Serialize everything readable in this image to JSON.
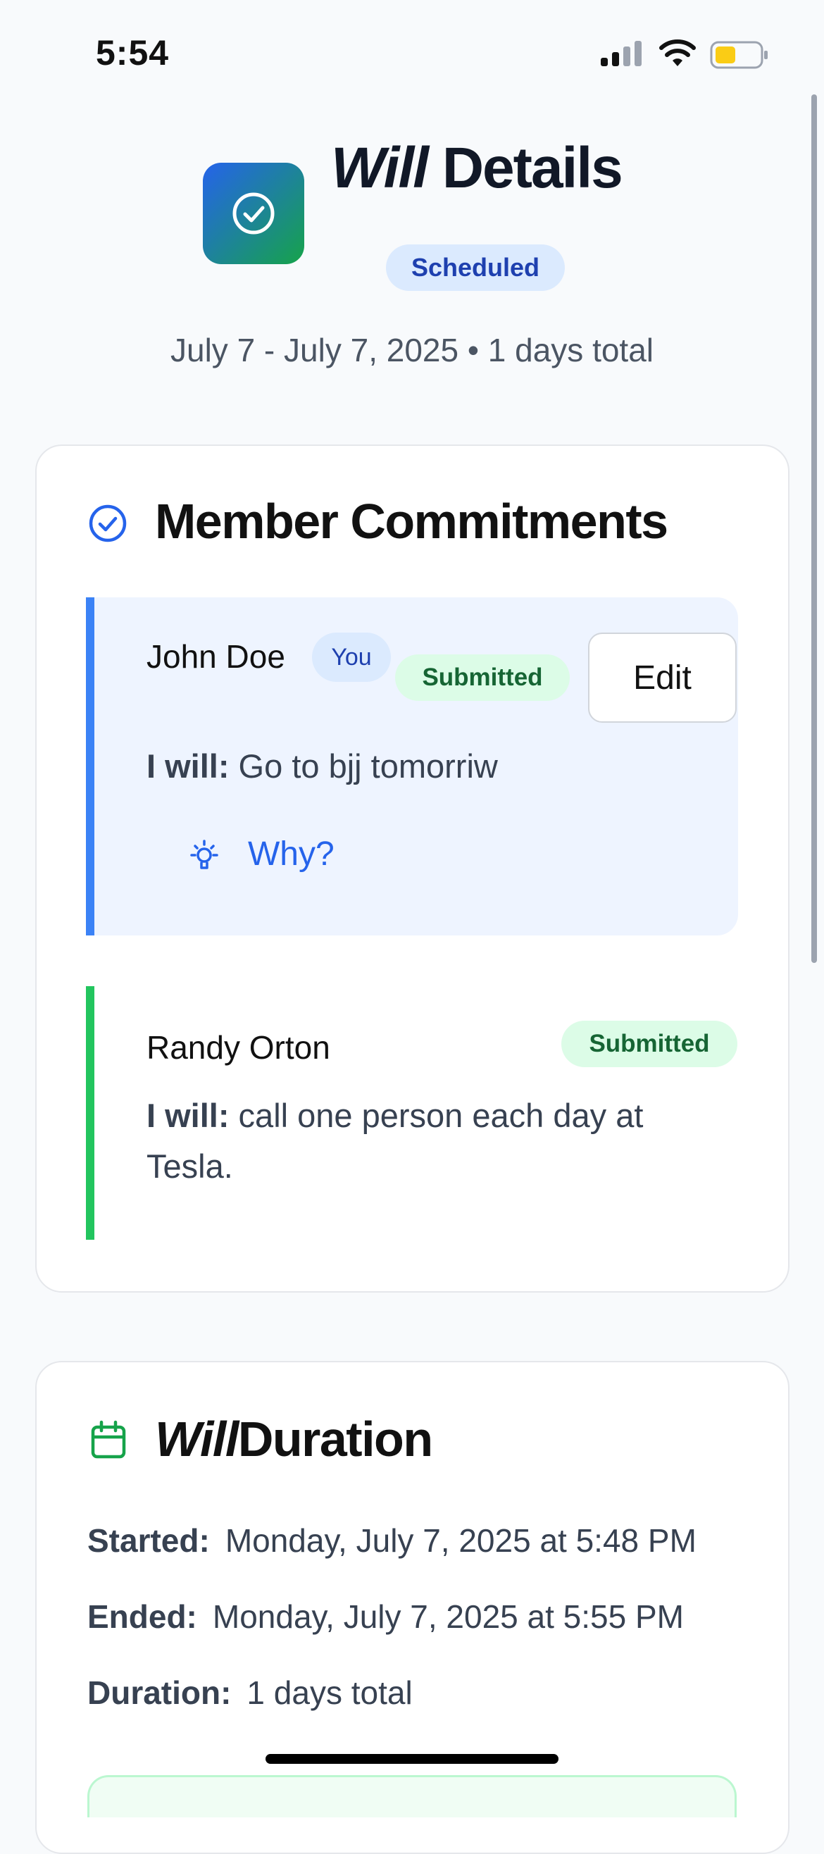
{
  "status_bar": {
    "time": "5:54"
  },
  "header": {
    "title_em": "Will",
    "title_rest": " Details",
    "status_badge": "Scheduled",
    "date_range": "July 7 - July 7, 2025 • 1 days total"
  },
  "commitments": {
    "title": "Member Commitments",
    "members": [
      {
        "name": "John Doe",
        "you_badge": "You",
        "status": "Submitted",
        "edit_label": "Edit",
        "prefix": "I will:",
        "text": " Go to bjj tomorriw",
        "why_label": "Why?",
        "accent": "#3b82f6"
      },
      {
        "name": "Randy Orton",
        "status": "Submitted",
        "prefix": "I will:",
        "text": " call one person each day at Tesla.",
        "accent": "#22c55e"
      }
    ]
  },
  "duration": {
    "title_em": "Will",
    "title_rest": "Duration",
    "started_label": "Started:",
    "started_value": "Monday, July 7, 2025 at 5:48 PM",
    "ended_label": "Ended:",
    "ended_value": "Monday, July 7, 2025 at 5:55 PM",
    "duration_label": "Duration:",
    "duration_value": "1 days total"
  },
  "icons": {
    "app": "check-circle-icon",
    "commitments": "check-circle-icon",
    "duration": "calendar-icon",
    "why": "lightbulb-icon"
  },
  "colors": {
    "brand_blue": "#2563eb",
    "brand_green": "#16a34a",
    "submitted_bg": "#dcfce7",
    "submitted_text": "#166534"
  }
}
